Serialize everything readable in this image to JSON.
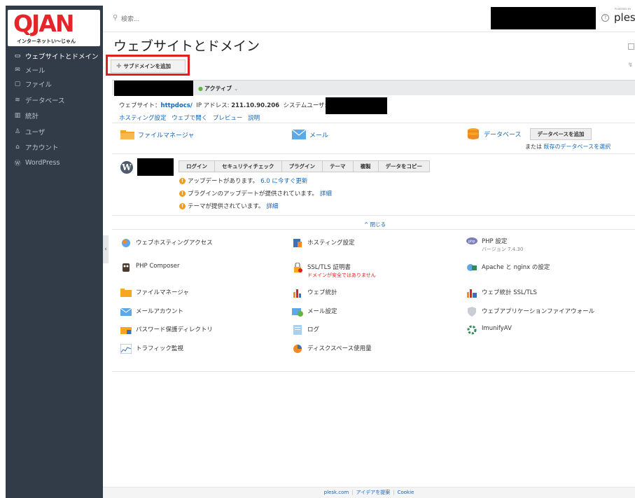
{
  "brand": {
    "logo_text": "QJAN",
    "tagline": "インターネットい〜じゃん",
    "accent": "#e4262b"
  },
  "sidebar": {
    "items": [
      {
        "label": "ウェブサイトとドメイン",
        "icon": "monitor-icon",
        "active": true
      },
      {
        "label": "メール",
        "icon": "mail-icon",
        "active": false
      },
      {
        "label": "ファイル",
        "icon": "folder-icon",
        "active": false
      },
      {
        "label": "データベース",
        "icon": "database-icon",
        "active": false
      },
      {
        "label": "統計",
        "icon": "bar-chart-icon",
        "active": false
      },
      {
        "label": "ユーザ",
        "icon": "user-icon",
        "active": false
      },
      {
        "label": "アカウント",
        "icon": "account-icon",
        "active": false
      },
      {
        "label": "WordPress",
        "icon": "wordpress-icon",
        "active": false
      }
    ]
  },
  "topbar": {
    "search_placeholder": "検索...",
    "product": "plesk",
    "powered_by": "POWERED BY"
  },
  "main": {
    "title": "ウェブサイトとドメイン",
    "add_subdomain": "サブドメインを追加",
    "status": "アクティブ",
    "info": {
      "website_label": "ウェブサイト：",
      "website_value": "httpdocs/",
      "ip_label": "IP アドレス: ",
      "ip_value": "211.10.90.206",
      "sysuser_label": "システムユーザ:"
    },
    "links": [
      "ホスティング設定",
      "ウェブで開く",
      "プレビュー",
      "説明"
    ],
    "quick": {
      "file_manager": "ファイルマネージャ",
      "mail": "メール",
      "databases": "データベース",
      "add_database": "データベースを追加",
      "or_text": "または",
      "select_existing": "既存のデータベースを選択"
    },
    "wordpress": {
      "buttons": [
        "ログイン",
        "セキュリティチェック",
        "プラグイン",
        "テーマ",
        "複製",
        "データをコピー"
      ],
      "notes": [
        {
          "text": "アップデートがあります。",
          "link": "6.0 に今すぐ更新"
        },
        {
          "text": "プラグインのアップデートが提供されています。",
          "link": "詳細"
        },
        {
          "text": "テーマが提供されています。",
          "link": "詳細"
        }
      ]
    },
    "collapse": "^ 閉じる",
    "tools": [
      {
        "label": "ウェブホスティングアクセス",
        "icon": "hosting-access-icon",
        "sub": ""
      },
      {
        "label": "ホスティング設定",
        "icon": "hosting-settings-icon",
        "sub": ""
      },
      {
        "label": "PHP 設定",
        "icon": "php-icon",
        "sub": "バージョン 7.4.30"
      },
      {
        "label": "PHP Composer",
        "icon": "composer-icon",
        "sub": ""
      },
      {
        "label": "SSL/TLS 証明書",
        "icon": "ssl-lock-icon",
        "sub": "ドメインが安全ではありません"
      },
      {
        "label": "Apache と nginx の設定",
        "icon": "apache-nginx-icon",
        "sub": ""
      },
      {
        "label": "ファイルマネージャ",
        "icon": "folder-icon",
        "sub": ""
      },
      {
        "label": "ウェブ統計",
        "icon": "web-stats-icon",
        "sub": ""
      },
      {
        "label": "ウェブ統計 SSL/TLS",
        "icon": "web-stats-ssl-icon",
        "sub": ""
      },
      {
        "label": "メールアカウント",
        "icon": "mail-account-icon",
        "sub": ""
      },
      {
        "label": "メール設定",
        "icon": "mail-settings-icon",
        "sub": ""
      },
      {
        "label": "ウェブアプリケーションファイアウォール",
        "icon": "firewall-shield-icon",
        "sub": ""
      },
      {
        "label": "パスワード保護ディレクトリ",
        "icon": "password-dir-icon",
        "sub": ""
      },
      {
        "label": "ログ",
        "icon": "log-icon",
        "sub": ""
      },
      {
        "label": "ImunifyAV",
        "icon": "imunify-icon",
        "sub": ""
      },
      {
        "label": "トラフィック監視",
        "icon": "traffic-icon",
        "sub": ""
      },
      {
        "label": "ディスクスペース使用量",
        "icon": "disk-usage-icon",
        "sub": ""
      }
    ]
  },
  "footer": {
    "links": [
      "plesk.com",
      "アイデアを提案",
      "Cookie"
    ]
  },
  "colors": {
    "sidebar_bg": "#323c49",
    "link": "#1464b4",
    "status_green": "#5fb641",
    "warning": "#f39b1c",
    "highlight_red": "#e0201c"
  }
}
